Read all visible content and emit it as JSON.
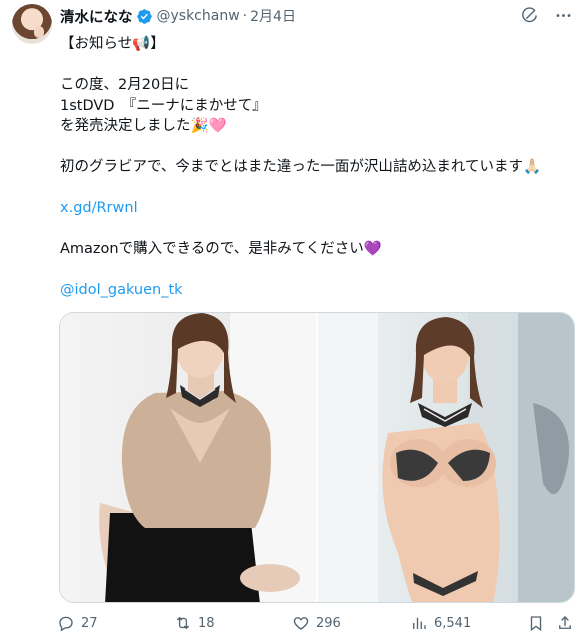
{
  "tweet": {
    "display_name": "清水になな",
    "handle": "@yskchanw",
    "separator": "·",
    "date": "2月4日",
    "lines": [
      "【お知らせ📢】",
      "",
      "この度、2月20日に",
      "1stDVD　『ニーナにまかせて』",
      "を発売決定しました🎉",
      "",
      "初のグラビアで、今までとはまた違った一面が沢山詰め込まれています🙏🏻",
      "",
      "x.gd/Rrwnl",
      "",
      "Amazonで購入できるので、是非みてください",
      "",
      "@idol_gakuen_tk"
    ],
    "heart_emoji": "🩷",
    "purple_heart_emoji": "💜"
  },
  "icons": {
    "verified": "verified-badge-icon",
    "grok": "grok-icon",
    "more": "more-icon",
    "reply": "reply-icon",
    "repost": "repost-icon",
    "like": "like-icon",
    "views": "views-icon",
    "bookmark": "bookmark-icon",
    "share": "share-icon"
  },
  "stats": {
    "replies": "27",
    "reposts": "18",
    "likes": "296",
    "views": "6,541"
  },
  "colors": {
    "link": "#1d9bf0",
    "verified": "#1d9bf0",
    "secondary_text": "#536471"
  }
}
